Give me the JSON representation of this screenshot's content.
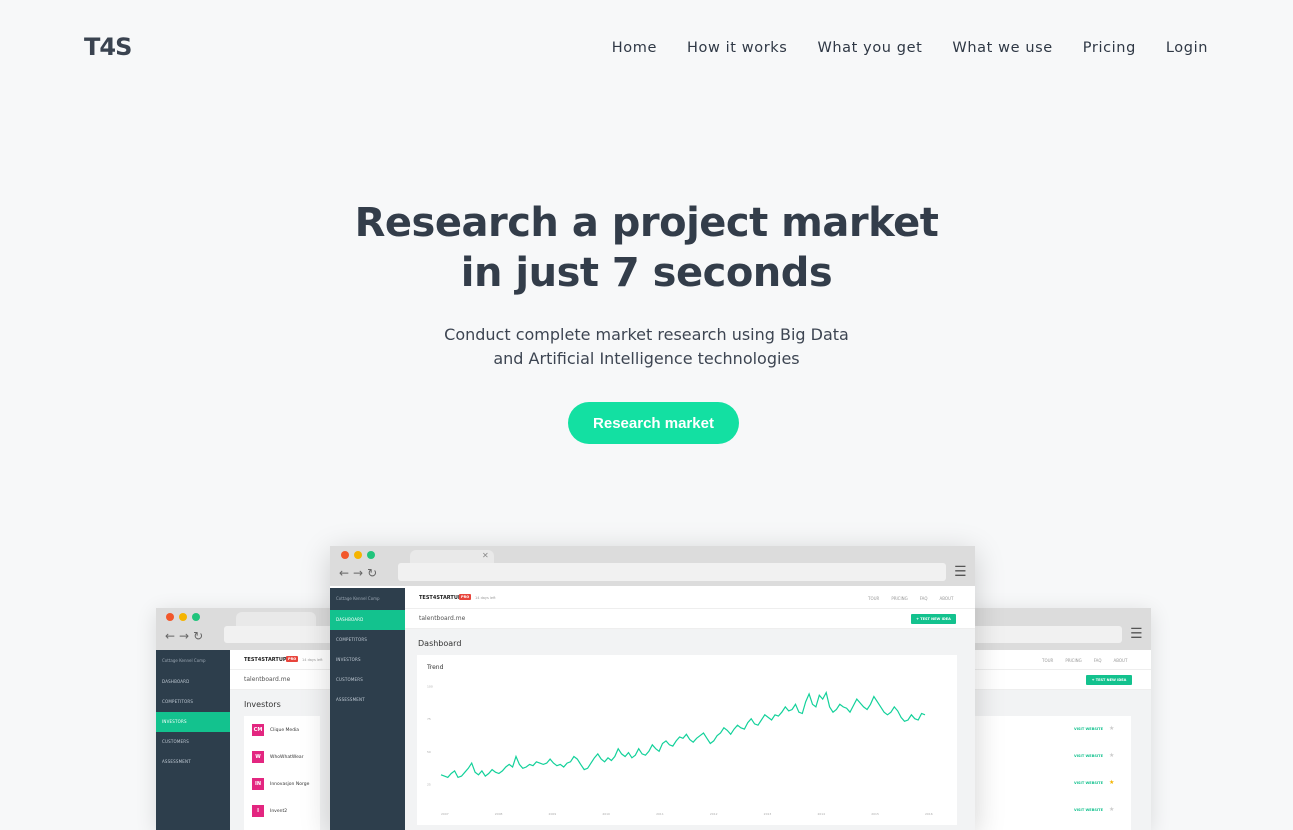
{
  "logo": "T4S",
  "nav": [
    "Home",
    "How it works",
    "What you get",
    "What we use",
    "Pricing",
    "Login"
  ],
  "hero": {
    "title_line1": "Research a project market",
    "title_line2": "in just 7 seconds",
    "subtitle_line1": "Conduct complete market research using Big Data",
    "subtitle_line2": "and Artificial Intelligence technologies",
    "cta": "Research market"
  },
  "colors": {
    "accent": "#13e0a2",
    "sidebar": "#2d3e4c",
    "sidebar_active": "#13c28e",
    "pro_badge": "#e8453c",
    "investor_logo": "#e32680"
  },
  "mockup": {
    "sidebar_header": "Cottage Kennel Comp",
    "sidebar_items": [
      "DASHBOARD",
      "COMPETITORS",
      "INVESTORS",
      "CUSTOMERS",
      "ASSESSMENT"
    ],
    "brand": "TEST4STARTUP",
    "pro": "PRO",
    "days": "14 days left",
    "toplinks": [
      "TOUR",
      "PRICING",
      "FAQ",
      "ABOUT"
    ],
    "domain": "talentboard.me",
    "test_button": "+ TEST NEW IDEA",
    "dashboard_title": "Dashboard",
    "trend_label": "Trend",
    "investors_title": "Investors",
    "investors": [
      {
        "initials": "CM",
        "name": "Clique Media"
      },
      {
        "initials": "W",
        "name": "WhoWhatWear"
      },
      {
        "initials": "IN",
        "name": "Innovasjon Norge"
      },
      {
        "initials": "I",
        "name": "Invent2"
      }
    ],
    "visit_label": "VISIT WEBSITE",
    "visit_stars": [
      false,
      false,
      true,
      false
    ]
  },
  "chart_data": {
    "type": "line",
    "title": "Trend",
    "xlabel": "",
    "ylabel": "",
    "x_ticks": [
      "2007",
      "2008",
      "2009",
      "2010",
      "2011",
      "2012",
      "2013",
      "2014",
      "2015",
      "2016"
    ],
    "y_ticks": [
      25,
      50,
      75,
      100
    ],
    "ylim": [
      15,
      110
    ],
    "series": [
      {
        "values": [
          32,
          31,
          30,
          33,
          35,
          30,
          31,
          34,
          37,
          41,
          34,
          32,
          35,
          31,
          33,
          36,
          34,
          33,
          35,
          38,
          40,
          38,
          46,
          40,
          37,
          38,
          40,
          39,
          42,
          41,
          40,
          41,
          44,
          41,
          39,
          40,
          38,
          41,
          42,
          46,
          44,
          40,
          36,
          37,
          41,
          45,
          48,
          44,
          42,
          45,
          43,
          46,
          52,
          48,
          46,
          49,
          45,
          47,
          52,
          48,
          47,
          50,
          55,
          52,
          50,
          56,
          58,
          55,
          54,
          58,
          61,
          60,
          63,
          59,
          57,
          60,
          62,
          64,
          60,
          56,
          58,
          62,
          64,
          68,
          66,
          63,
          67,
          70,
          68,
          67,
          72,
          75,
          71,
          70,
          74,
          78,
          76,
          74,
          78,
          77,
          80,
          84,
          81,
          82,
          86,
          80,
          79,
          88,
          94,
          86,
          84,
          93,
          90,
          95,
          84,
          80,
          82,
          86,
          84,
          83,
          80,
          85,
          90,
          87,
          84,
          82,
          86,
          92,
          88,
          84,
          80,
          78,
          80,
          84,
          81,
          76,
          73,
          74,
          78,
          75,
          74,
          79,
          78
        ]
      }
    ]
  }
}
